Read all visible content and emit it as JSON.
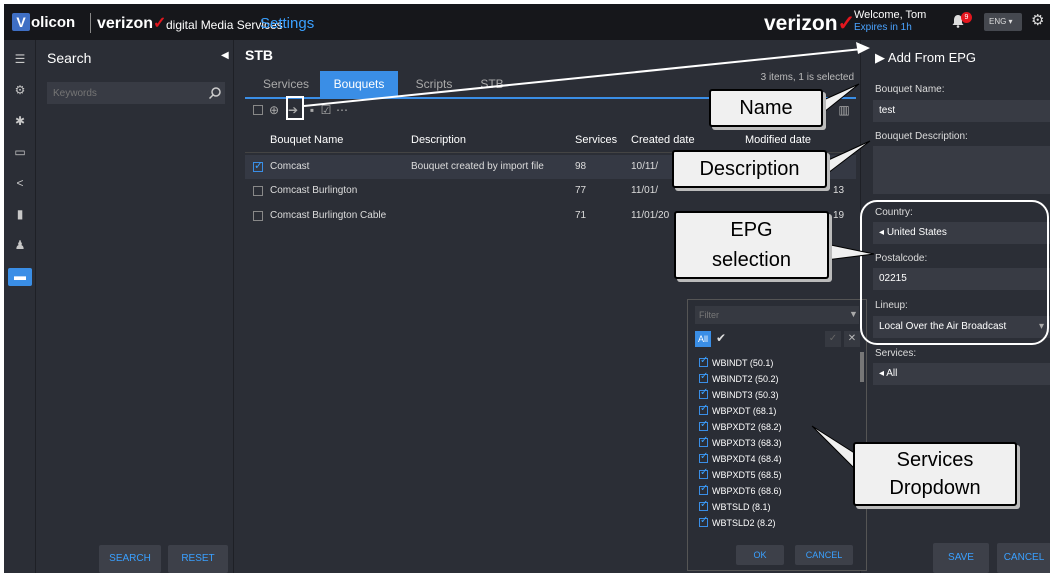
{
  "app": {
    "logo_letter": "V",
    "brand": "olicon",
    "carrier": "verizon",
    "carrier_mark": "✓",
    "product": "digital Media Services",
    "page": "Settings",
    "carrier_big": "verizon",
    "welcome": "Welcome, Tom",
    "expires": "Expires in 1h",
    "notifications": "9",
    "language": "ENG ▾"
  },
  "search_panel": {
    "title": "Search",
    "placeholder": "Keywords",
    "search_btn": "SEARCH",
    "reset_btn": "RESET"
  },
  "main": {
    "title": "STB",
    "tabs": [
      "Services",
      "Bouquets",
      "Scripts",
      "STB"
    ],
    "active_tab": "Bouquets",
    "items_info": "3 items, 1 is selected",
    "columns": [
      "Bouquet Name",
      "Description",
      "Services",
      "Created date",
      "Modified date"
    ],
    "rows": [
      {
        "name": "Comcast",
        "description": "Bouquet created by import file",
        "services": "98",
        "created": "10/11/",
        "modified": "",
        "checked": true
      },
      {
        "name": "Comcast Burlington",
        "description": "",
        "services": "77",
        "created": "11/01/",
        "modified": "13",
        "checked": false
      },
      {
        "name": "Comcast Burlington Cable",
        "description": "",
        "services": "71",
        "created": "11/01/20",
        "modified": "19",
        "checked": false
      }
    ]
  },
  "right_panel": {
    "title": "Add From EPG",
    "bouquet_name_label": "Bouquet Name:",
    "bouquet_name_value": "test",
    "description_label": "Bouquet Description:",
    "country_label": "Country:",
    "country_value": "United States",
    "postal_label": "Postalcode:",
    "postal_value": "02215",
    "lineup_label": "Lineup:",
    "lineup_value": "Local Over the Air Broadcast",
    "services_label": "Services:",
    "services_value": "All",
    "save_btn": "SAVE",
    "cancel_btn": "CANCEL"
  },
  "dropdown": {
    "filter_placeholder": "Filter",
    "all_label": "All",
    "items": [
      "WBINDT (50.1)",
      "WBINDT2 (50.2)",
      "WBINDT3 (50.3)",
      "WBPXDT (68.1)",
      "WBPXDT2 (68.2)",
      "WBPXDT3 (68.3)",
      "WBPXDT4 (68.4)",
      "WBPXDT5 (68.5)",
      "WBPXDT6 (68.6)",
      "WBTSLD (8.1)",
      "WBTSLD2 (8.2)"
    ],
    "ok_btn": "OK",
    "cancel_btn": "CANCEL"
  },
  "callouts": {
    "name": "Name",
    "description": "Description",
    "epg_line1": "EPG",
    "epg_line2": "selection",
    "services_line1": "Services",
    "services_line2": "Dropdown"
  },
  "colors": {
    "accent": "#3a8ee6",
    "brand_red": "#e3161e",
    "background": "#2b2e36"
  }
}
